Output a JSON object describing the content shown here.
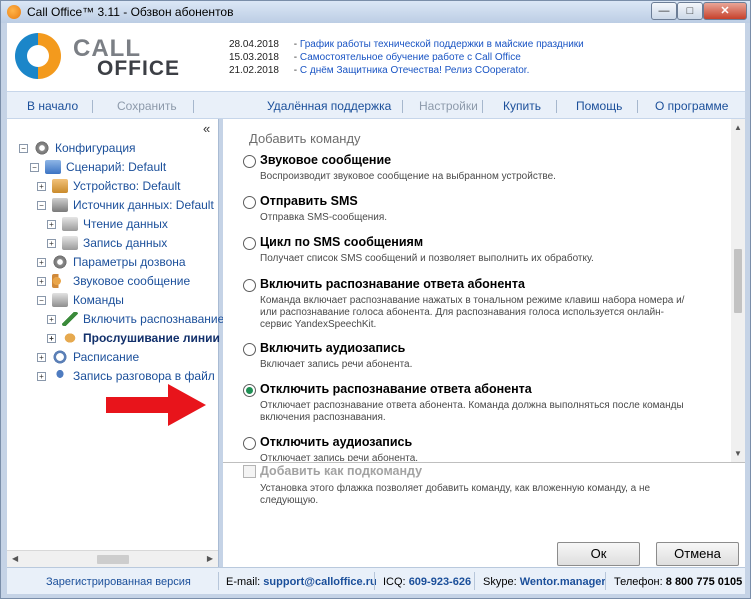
{
  "window": {
    "title": "Call Office™ 3.11 - Обзвон абонентов",
    "controls": {
      "minimize": "—",
      "maximize": "□",
      "close": "✕"
    }
  },
  "logo": {
    "line1": "CALL",
    "line2": "OFFICE"
  },
  "news": [
    {
      "date": "28.04.2018",
      "text": "График работы технической поддержки в майские праздники"
    },
    {
      "date": "15.03.2018",
      "text": "Самостоятельное обучение работе с Call Office"
    },
    {
      "date": "21.02.2018",
      "text": "С днём Защитника Отечества! Релиз COoperator."
    }
  ],
  "toolbar": {
    "home": "В начало",
    "save": "Сохранить",
    "remote": "Удалённая поддержка",
    "settings": "Настройки",
    "buy": "Купить",
    "help": "Помощь",
    "about": "О программе"
  },
  "tree": {
    "collapse": "«",
    "items": [
      {
        "label": "Конфигурация",
        "icon": "gear-icon"
      },
      {
        "label": "Сценарий: Default",
        "icon": "scenario-icon"
      },
      {
        "label": "Устройство: Default",
        "icon": "device-icon"
      },
      {
        "label": "Источник данных: Default",
        "icon": "database-icon"
      },
      {
        "label": "Чтение данных",
        "icon": "read-icon"
      },
      {
        "label": "Запись данных",
        "icon": "write-icon"
      },
      {
        "label": "Параметры дозвона",
        "icon": "gear-icon"
      },
      {
        "label": "Звуковое сообщение",
        "icon": "sound-icon"
      },
      {
        "label": "Команды",
        "icon": "commands-icon"
      },
      {
        "label": "Включить распознавание",
        "icon": "pencil-icon"
      },
      {
        "label": "Прослушивание линии",
        "icon": "ear-icon"
      },
      {
        "label": "Расписание",
        "icon": "clock-icon"
      },
      {
        "label": "Запись разговора в файл",
        "icon": "microphone-icon"
      }
    ]
  },
  "content": {
    "section_title": "Добавить команду",
    "options": [
      {
        "title": "Звуковое сообщение",
        "desc": "Воспроизводит звуковое сообщение на выбранном устройстве."
      },
      {
        "title": "Отправить SMS",
        "desc": "Отправка SMS-сообщения."
      },
      {
        "title": "Цикл по SMS сообщениям",
        "desc": "Получает список SMS сообщений и позволяет выполнить их обработку."
      },
      {
        "title": "Включить распознавание ответа абонента",
        "desc": "Команда включает распознавание нажатых в тональном режиме клавиш набора номера и/или распознавание голоса абонента. Для распознавания голоса используется онлайн-сервис YandexSpeechKit."
      },
      {
        "title": "Включить аудиозапись",
        "desc": "Включает запись речи абонента."
      },
      {
        "title": "Отключить распознавание ответа абонента",
        "desc": "Отключает распознавание ответа абонента. Команда должна выполняться после команды включения распознавания.",
        "selected": true
      },
      {
        "title": "Отключить аудиозапись",
        "desc": "Отключает запись речи абонента."
      }
    ],
    "subcommand_label": "Добавить как подкоманду",
    "subcommand_desc": "Установка этого флажка позволяет добавить команду, как вложенную команду, а не следующую.",
    "ok": "Ок",
    "cancel": "Отмена"
  },
  "status": {
    "registered": "Зарегистрированная версия",
    "email_label": "E-mail:",
    "email": "support@calloffice.ru",
    "icq_label": "ICQ:",
    "icq": "609-923-626",
    "skype_label": "Skype:",
    "skype": "Wentor.manager",
    "phone_label": "Телефон:",
    "phone": "8 800 775 0105"
  },
  "colors": {
    "accent_link": "#1b4f9a",
    "selected_radio": "#1f8f54",
    "arrow": "#e8141b"
  }
}
